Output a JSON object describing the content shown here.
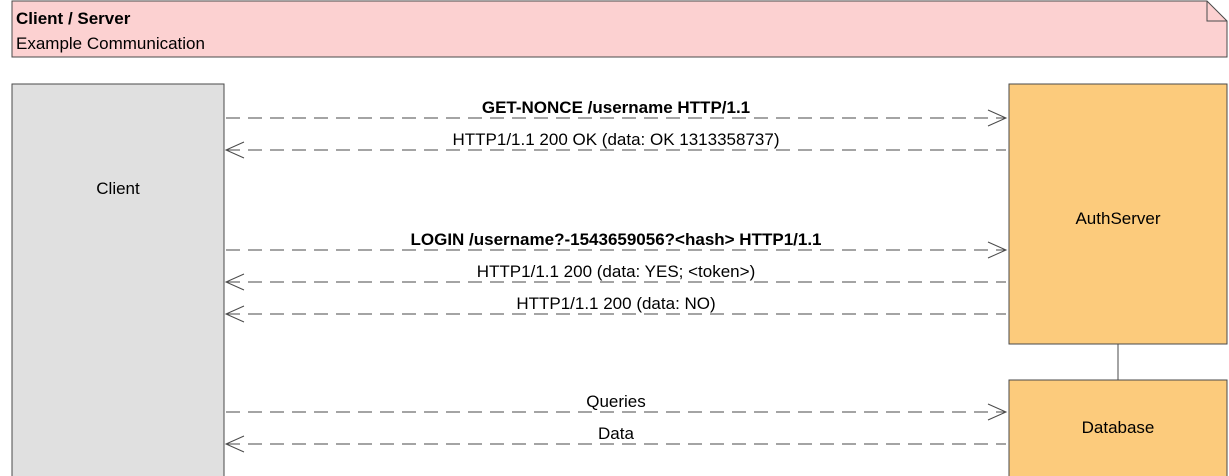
{
  "note": {
    "title": "Client / Server",
    "subtitle": "Example Communication"
  },
  "colors": {
    "note_fill": "#fcd1d1",
    "client_fill": "#e0e0e0",
    "server_fill": "#fccb7c",
    "line": "#4a4a4a"
  },
  "participants": {
    "client": "Client",
    "authserver": "AuthServer",
    "database": "Database"
  },
  "messages": [
    {
      "label": "GET-NONCE /username HTTP/1.1",
      "direction": "right",
      "bold": true
    },
    {
      "label": "HTTP1/1.1 200 OK (data: OK 1313358737)",
      "direction": "left",
      "bold": false
    },
    {
      "label": "LOGIN /username?-1543659056?<hash> HTTP1/1.1",
      "direction": "right",
      "bold": true
    },
    {
      "label": "HTTP1/1.1 200 (data: YES; <token>)",
      "direction": "left",
      "bold": false
    },
    {
      "label": "HTTP1/1.1 200 (data: NO)",
      "direction": "left",
      "bold": false
    },
    {
      "label": "Queries",
      "direction": "right",
      "bold": false
    },
    {
      "label": "Data",
      "direction": "left",
      "bold": false
    }
  ]
}
